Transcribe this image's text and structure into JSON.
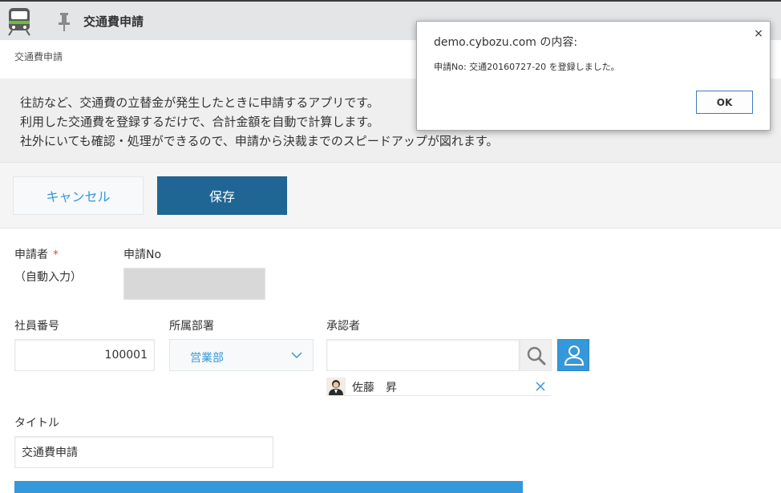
{
  "header": {
    "app_icon": "train-icon",
    "pin_icon": "pin-icon",
    "title": "交通費申請"
  },
  "breadcrumb": "交通費申請",
  "description": [
    "往訪など、交通費の立替金が発生したときに申請するアプリです。",
    "利用した交通費を登録するだけで、合計金額を自動で計算します。",
    "社外にいても確認・処理ができるので、申請から決裁までのスピードアップが図れます。"
  ],
  "toolbar": {
    "cancel_label": "キャンセル",
    "save_label": "保存"
  },
  "form": {
    "applicant": {
      "label": "申請者",
      "required_mark": "*",
      "note": "（自動入力）"
    },
    "request_no": {
      "label": "申請No",
      "value": ""
    },
    "employee_no": {
      "label": "社員番号",
      "value": "100001"
    },
    "department": {
      "label": "所属部署",
      "value": "営業部"
    },
    "approver": {
      "label": "承認者",
      "input_value": "",
      "selected_user": "佐藤　昇"
    },
    "title": {
      "label": "タイトル",
      "value": "交通費申請"
    }
  },
  "dialog": {
    "title": "demo.cybozu.com の内容:",
    "message": "申請No: 交通20160727-20 を登録しました。",
    "ok_label": "OK",
    "close_glyph": "×"
  },
  "colors": {
    "accent": "#3498db",
    "save_button": "#206694",
    "required": "#e74c3c",
    "header_bg": "#e3e5e7"
  }
}
